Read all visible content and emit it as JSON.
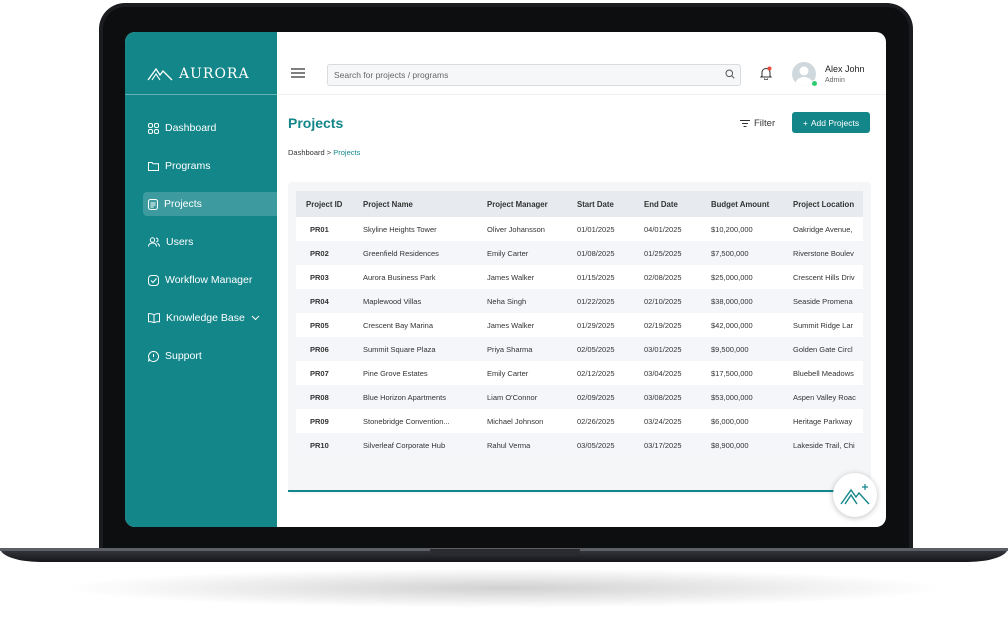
{
  "brand": {
    "name": "AURORA"
  },
  "sidebar": {
    "items": [
      {
        "label": "Dashboard",
        "icon": "grid-icon"
      },
      {
        "label": "Programs",
        "icon": "folder-icon"
      },
      {
        "label": "Projects",
        "icon": "document-icon",
        "active": true
      },
      {
        "label": "Users",
        "icon": "users-icon"
      },
      {
        "label": "Workflow Manager",
        "icon": "check-square-icon"
      },
      {
        "label": "Knowledge Base",
        "icon": "book-icon",
        "has_dropdown": true
      },
      {
        "label": "Support",
        "icon": "chat-icon"
      }
    ]
  },
  "header": {
    "search_placeholder": "Search for projects / programs",
    "user": {
      "name": "Alex John",
      "role": "Admin",
      "status": "online"
    }
  },
  "page": {
    "title": "Projects",
    "filter_label": "Filter",
    "add_button_label": "Add Projects",
    "breadcrumb": {
      "root": "Dashboard",
      "separator": " > ",
      "current": "Projects"
    }
  },
  "table": {
    "columns": [
      "Project ID",
      "Project Name",
      "Project Manager",
      "Start Date",
      "End Date",
      "Budget Amount",
      "Project Location"
    ],
    "rows": [
      [
        "PR01",
        "Skyline Heights Tower",
        "Oliver Johansson",
        "01/01/2025",
        "04/01/2025",
        "$10,200,000",
        "Oakridge Avenue,"
      ],
      [
        "PR02",
        "Greenfield Residences",
        "Emily Carter",
        "01/08/2025",
        "01/25/2025",
        "$7,500,000",
        "Riverstone Boulev"
      ],
      [
        "PR03",
        "Aurora Business Park",
        "James Walker",
        "01/15/2025",
        "02/08/2025",
        "$25,000,000",
        "Crescent Hills Driv"
      ],
      [
        "PR04",
        "Maplewood Villas",
        "Neha Singh",
        "01/22/2025",
        "02/10/2025",
        "$38,000,000",
        "Seaside Promena"
      ],
      [
        "PR05",
        "Crescent Bay Marina",
        "James Walker",
        "01/29/2025",
        "02/19/2025",
        "$42,000,000",
        "Summit Ridge Lar"
      ],
      [
        "PR06",
        "Summit Square Plaza",
        "Priya Sharma",
        "02/05/2025",
        "03/01/2025",
        "$9,500,000",
        "Golden Gate Circl"
      ],
      [
        "PR07",
        "Pine Grove Estates",
        "Emily Carter",
        "02/12/2025",
        "03/04/2025",
        "$17,500,000",
        "Bluebell Meadows"
      ],
      [
        "PR08",
        "Blue Horizon Apartments",
        "Liam O'Connor",
        "02/09/2025",
        "03/08/2025",
        "$53,000,000",
        "Aspen Valley Roac"
      ],
      [
        "PR09",
        "Stonebridge Convention...",
        "Michael Johnson",
        "02/26/2025",
        "03/24/2025",
        "$6,000,000",
        "Heritage Parkway"
      ],
      [
        "PR10",
        "Silverleaf Corporate Hub",
        "Rahul Verma",
        "03/05/2025",
        "03/17/2025",
        "$8,900,000",
        "Lakeside Trail, Chi"
      ]
    ]
  },
  "colors": {
    "accent": "#13868a",
    "sidebar_bg": "#13868a",
    "header_row_bg": "#e7eaee",
    "online": "#2ecc71"
  }
}
